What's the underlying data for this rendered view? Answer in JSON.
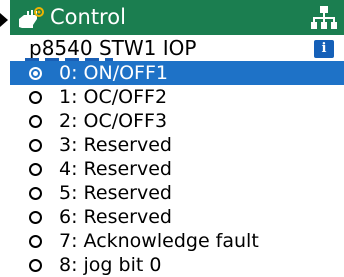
{
  "header": {
    "title": "Control",
    "title_icon": "hand-gear-icon",
    "network_icon": "network-tree-icon"
  },
  "parameter": {
    "text": "p8540 STW1 IOP",
    "info_icon": "info-icon",
    "info_glyph": "i"
  },
  "options": [
    {
      "label": "0: ON/OFF1",
      "selected": true
    },
    {
      "label": "1: OC/OFF2",
      "selected": false
    },
    {
      "label": "2: OC/OFF3",
      "selected": false
    },
    {
      "label": "3: Reserved",
      "selected": false
    },
    {
      "label": "4: Reserved",
      "selected": false
    },
    {
      "label": "5: Reserved",
      "selected": false
    },
    {
      "label": "6: Reserved",
      "selected": false
    },
    {
      "label": "7: Acknowledge fault",
      "selected": false
    },
    {
      "label": "8: jog bit 0",
      "selected": false
    }
  ],
  "colors": {
    "titlebar": "#1b7e50",
    "selection": "#1e72c7",
    "info": "#1560b8"
  }
}
